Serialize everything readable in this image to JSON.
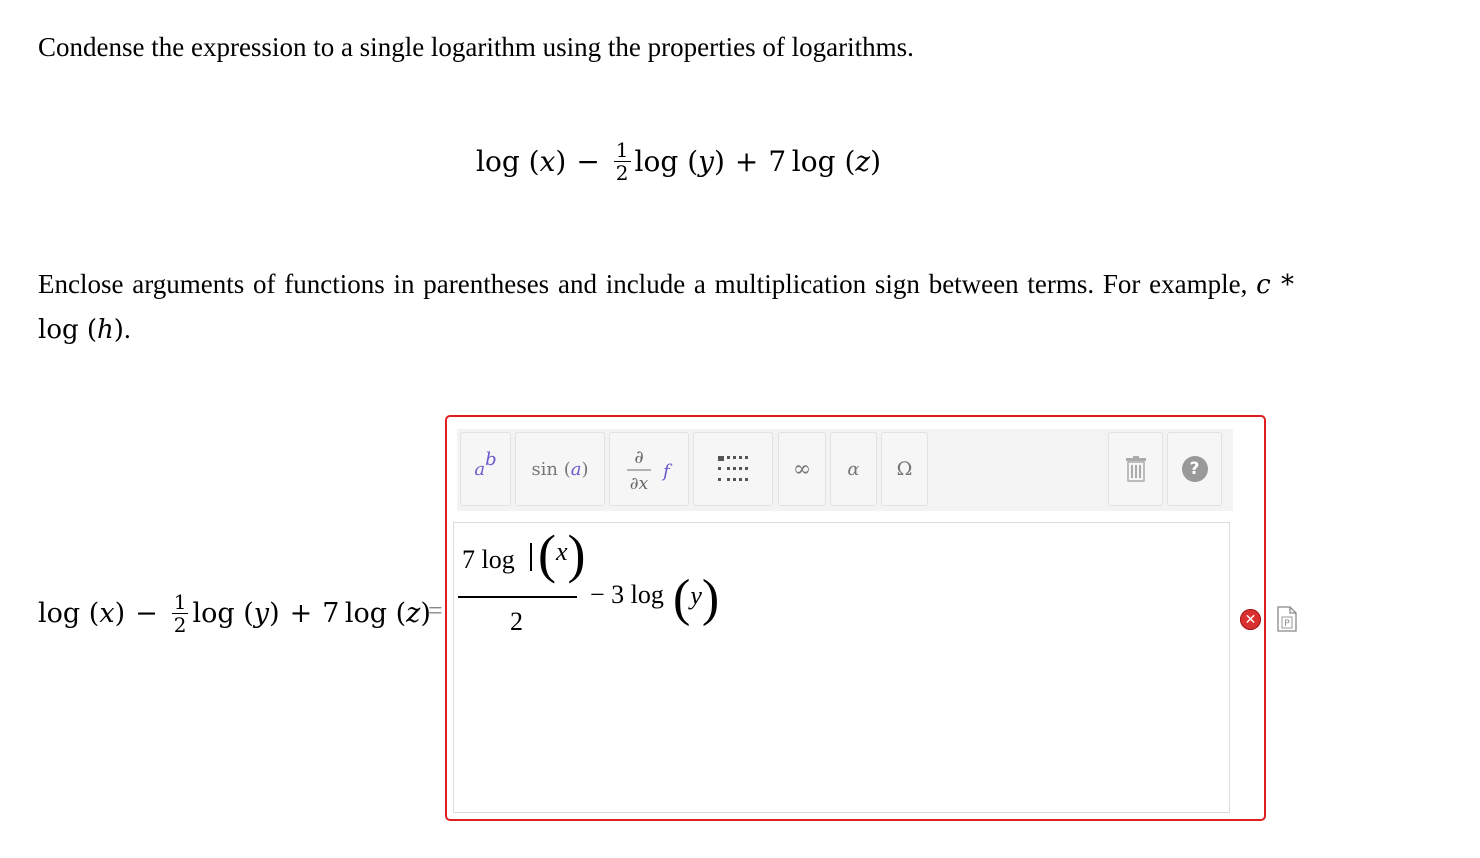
{
  "prompt": {
    "text": "Condense the expression to a single logarithm using the properties of logarithms."
  },
  "expression": {
    "log": "log",
    "x": "x",
    "y": "y",
    "z": "z",
    "minus": "−",
    "plus": "+",
    "frac_num": "1",
    "frac_den": "2",
    "coef": "7",
    "lparen": "(",
    "rparen": ")"
  },
  "instructions": {
    "text": "Enclose arguments of functions in parentheses and include a multiplication sign between terms. For example,",
    "example_c": "c",
    "example_star": " * ",
    "example_log": "log",
    "example_h": "h",
    "period": "."
  },
  "answer_row": {
    "equals": "="
  },
  "toolbar": {
    "power_base": "a",
    "power_exp": "b",
    "sin_fn": "sin",
    "sin_arg": "a",
    "deriv_num": "∂",
    "deriv_den": "∂x",
    "deriv_f": "f",
    "infinity": "∞",
    "alpha": "α",
    "omega": "Ω",
    "help": "?"
  },
  "input": {
    "frac_coef": "7",
    "frac_log": "log",
    "frac_arg": "x",
    "frac_den": "2",
    "minus": "−",
    "coef2": "3",
    "log2": "log",
    "arg2": "y"
  },
  "status": {
    "error_symbol": "✕"
  },
  "colors": {
    "frame_border": "#e02020",
    "toolbar_accent": "#6a5acd",
    "error_red": "#d93030"
  }
}
